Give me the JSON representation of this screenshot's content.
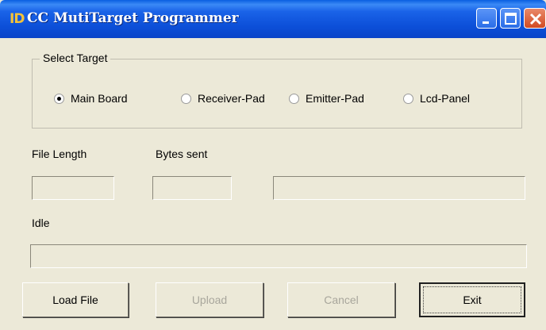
{
  "window": {
    "icon_text": "ID",
    "title": "CC MutiTarget Programmer"
  },
  "select_target": {
    "label": "Select Target",
    "options": [
      {
        "label": "Main Board",
        "selected": true
      },
      {
        "label": "Receiver-Pad",
        "selected": false
      },
      {
        "label": "Emitter-Pad",
        "selected": false
      },
      {
        "label": "Lcd-Panel",
        "selected": false
      }
    ]
  },
  "file_length": {
    "label": "File Length",
    "value": ""
  },
  "bytes_sent": {
    "label": "Bytes sent",
    "value": ""
  },
  "transfer_progress": {
    "value": 0
  },
  "status": {
    "text": "Idle",
    "progress": 0
  },
  "buttons": {
    "load_file": "Load File",
    "upload": "Upload",
    "cancel": "Cancel",
    "exit": "Exit"
  }
}
